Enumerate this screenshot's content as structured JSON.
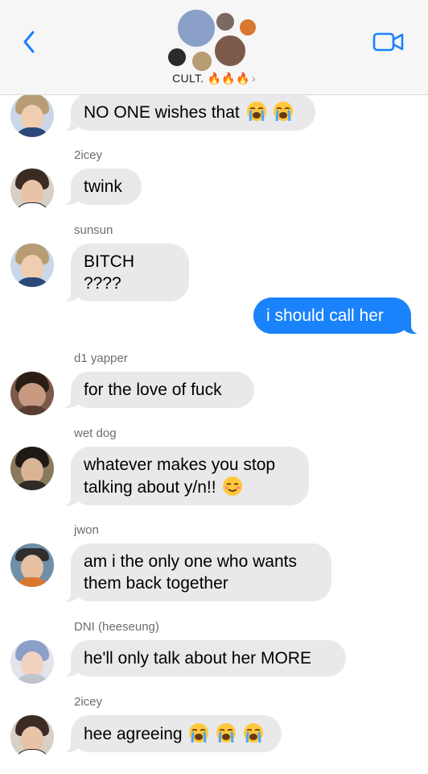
{
  "header": {
    "group_name": "CULT. 🔥🔥🔥",
    "chevron": "›",
    "back_icon": "chevron-left-icon",
    "video_icon": "video-camera-icon"
  },
  "colors": {
    "accent": "#1a82fb",
    "incoming_bubble": "#e9e9eb",
    "header_bg": "#f6f6f7"
  },
  "messages": [
    {
      "sender": "",
      "text": "NO ONE wishes that",
      "emoji": [
        "crying",
        "crying"
      ],
      "direction": "in"
    },
    {
      "sender": "2icey",
      "text": "twink",
      "emoji": [],
      "direction": "in"
    },
    {
      "sender": "sunsun",
      "text": "BITCH ????",
      "emoji": [],
      "direction": "in"
    },
    {
      "sender": "",
      "text": "i should call her",
      "emoji": [],
      "direction": "out"
    },
    {
      "sender": "d1 yapper",
      "text": "for the love of fuck",
      "emoji": [],
      "direction": "in"
    },
    {
      "sender": "wet dog",
      "text": "whatever makes you stop\ntalking about y/n!!",
      "emoji": [
        "blush"
      ],
      "direction": "in"
    },
    {
      "sender": "jwon",
      "text": "am i the only one who wants\nthem back together",
      "emoji": [],
      "direction": "in"
    },
    {
      "sender": "DNI (heeseung)",
      "text": "he'll only talk about her MORE",
      "emoji": [],
      "direction": "in"
    },
    {
      "sender": "2icey",
      "text": "hee agreeing",
      "emoji": [
        "crying",
        "crying",
        "crying"
      ],
      "direction": "in"
    }
  ]
}
